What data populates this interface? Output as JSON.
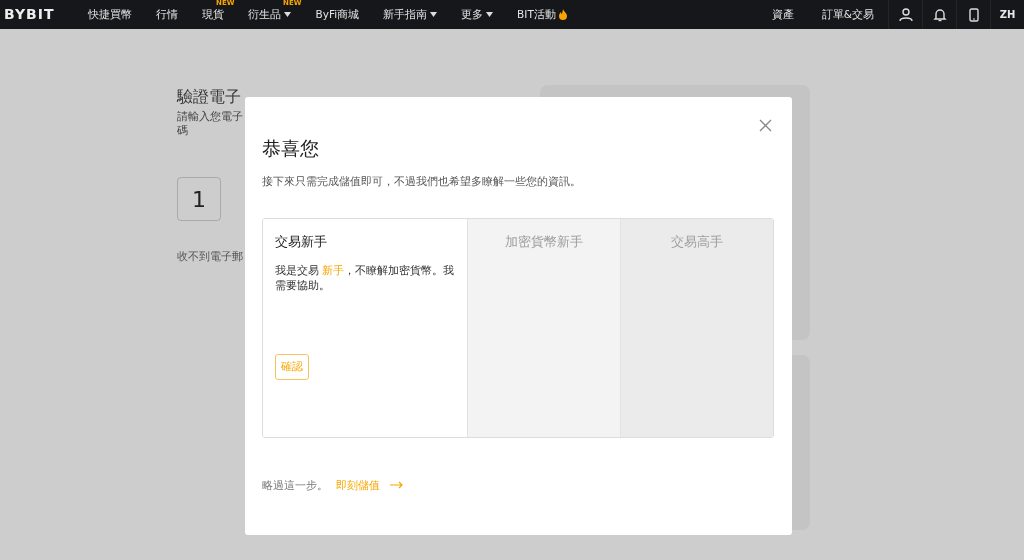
{
  "navbar": {
    "logo": "BYBIT",
    "items": [
      {
        "label": "快捷買幣",
        "dropdown": false,
        "flame": false
      },
      {
        "label": "行情",
        "dropdown": false,
        "flame": false
      },
      {
        "label": "現貨",
        "badge": "NEW",
        "dropdown": false,
        "flame": false
      },
      {
        "label": "衍生品",
        "badge": "NEW",
        "dropdown": true,
        "flame": false
      },
      {
        "label": "ByFi商城",
        "dropdown": false,
        "flame": false
      },
      {
        "label": "新手指南",
        "dropdown": true,
        "flame": false
      },
      {
        "label": "更多",
        "dropdown": true,
        "flame": false
      },
      {
        "label": "BIT活動",
        "dropdown": false,
        "flame": true
      }
    ],
    "right_links": [
      "資產",
      "訂單&交易"
    ],
    "language": "ZH"
  },
  "background_page": {
    "title": "驗證電子",
    "subtitle_lines": [
      "請輸入您電子",
      "碼"
    ],
    "code_digits": [
      "1"
    ],
    "resend_text": "收不到電子郵"
  },
  "dialog": {
    "title": "恭喜您",
    "subtitle": "接下來只需完成儲值即可，不過我們也希望多瞭解一些您的資訊。",
    "options": [
      {
        "title": "交易新手",
        "selected": true,
        "description": [
          {
            "text": "我是交易 ",
            "highlight": false
          },
          {
            "text": "新手",
            "highlight": true
          },
          {
            "text": "，不瞭解加密貨幣。我需要協助。",
            "highlight": false
          }
        ],
        "button": "確認"
      },
      {
        "title": "加密貨幣新手",
        "selected": false
      },
      {
        "title": "交易高手",
        "selected": false
      }
    ],
    "skip_text": "略過這一步。",
    "deposit_link": "即刻儲值"
  }
}
